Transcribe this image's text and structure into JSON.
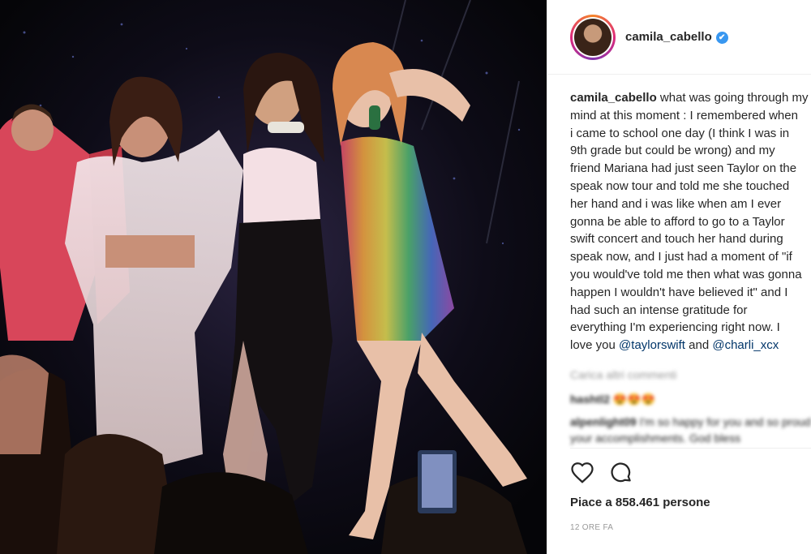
{
  "post": {
    "username": "camila_cabello",
    "verified_badge": "verified-checkmark-icon",
    "caption": {
      "username": "camila_cabello",
      "text_lines": [
        " what was going through my",
        "mind at this moment : I remembered when",
        "i came to school one day (I think I was in",
        "9th grade but could be wrong) and my",
        "friend Mariana had just seen Taylor on the",
        "speak now tour and told me she touched",
        "her hand and i was like when am I ever",
        "gonna be able to afford to go to a Taylor",
        "swift concert and touch her hand during",
        "speak now, and I just had a moment of \"if",
        "you would've told me then what was gonna",
        "happen I wouldn't have believed it\" and I",
        "had such an intense gratitude for",
        "everything I'm experiencing right now. I"
      ],
      "last_line_prefix": "love you ",
      "mention_1": "@taylorswift",
      "and_text": " and ",
      "mention_2": "@charli_xcx"
    },
    "comments": {
      "load_more": "Carica altri commenti",
      "items": [
        {
          "user": "hashtl2",
          "text": "😍😍😍"
        },
        {
          "user": "alpenlight09",
          "text": "I'm so happy for you and so proud of your accomplishments. God bless"
        }
      ]
    },
    "actions": {
      "like_icon": "heart-icon",
      "comment_icon": "comment-bubble-icon"
    },
    "likes_text": "Piace a 858.461 persone",
    "timestamp": "12 ORE FA"
  },
  "colors": {
    "text": "#262626",
    "mention": "#003569",
    "muted": "#999999",
    "verified": "#3897f0"
  }
}
